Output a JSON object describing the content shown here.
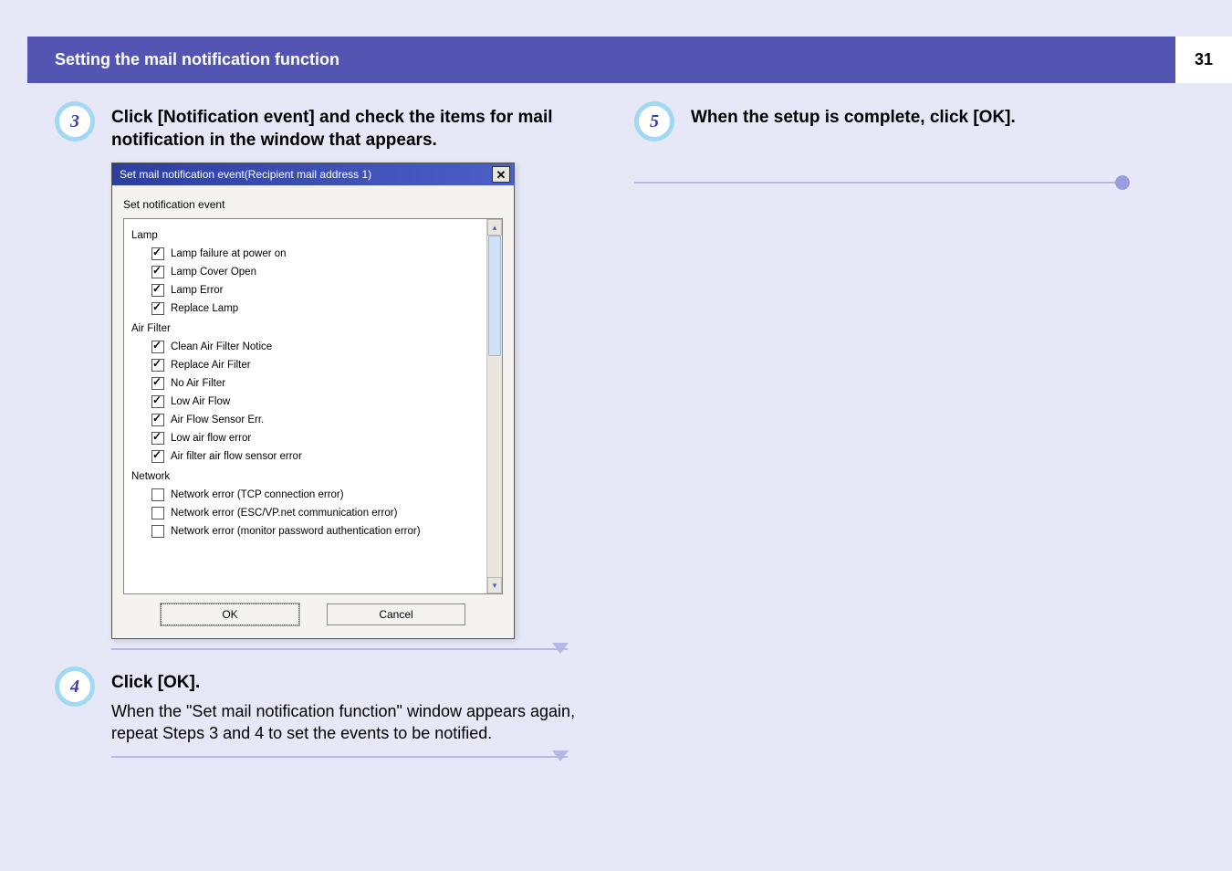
{
  "header": {
    "title": "Setting the mail notification function",
    "page_number": "31"
  },
  "left": {
    "step3": {
      "num": "3",
      "text": "Click [Notification event] and check the items for mail notification in the window that appears."
    },
    "dialog": {
      "title": "Set mail notification event(Recipient mail address 1)",
      "subtitle": "Set notification event",
      "group_lamp": "Lamp",
      "lamp_items": [
        {
          "label": "Lamp failure at power on",
          "checked": true
        },
        {
          "label": "Lamp Cover Open",
          "checked": true
        },
        {
          "label": "Lamp Error",
          "checked": true
        },
        {
          "label": "Replace Lamp",
          "checked": true
        }
      ],
      "group_air": "Air Filter",
      "air_items": [
        {
          "label": "Clean Air Filter Notice",
          "checked": true
        },
        {
          "label": "Replace Air Filter",
          "checked": true
        },
        {
          "label": "No Air Filter",
          "checked": true
        },
        {
          "label": "Low Air Flow",
          "checked": true
        },
        {
          "label": "Air Flow Sensor Err.",
          "checked": true
        },
        {
          "label": "Low air flow error",
          "checked": true
        },
        {
          "label": "Air filter air flow sensor error",
          "checked": true
        }
      ],
      "group_net": "Network",
      "net_items": [
        {
          "label": "Network error (TCP connection error)",
          "checked": false
        },
        {
          "label": "Network error (ESC/VP.net communication error)",
          "checked": false
        },
        {
          "label": "Network error (monitor password authentication error)",
          "checked": false
        }
      ],
      "ok": "OK",
      "cancel": "Cancel"
    },
    "step4": {
      "num": "4",
      "heading": "Click [OK].",
      "body": "When the \"Set mail notification function\" window appears again, repeat Steps 3 and 4 to set the events to be notified."
    }
  },
  "right": {
    "step5": {
      "num": "5",
      "text": "When the setup is complete, click [OK]."
    }
  }
}
